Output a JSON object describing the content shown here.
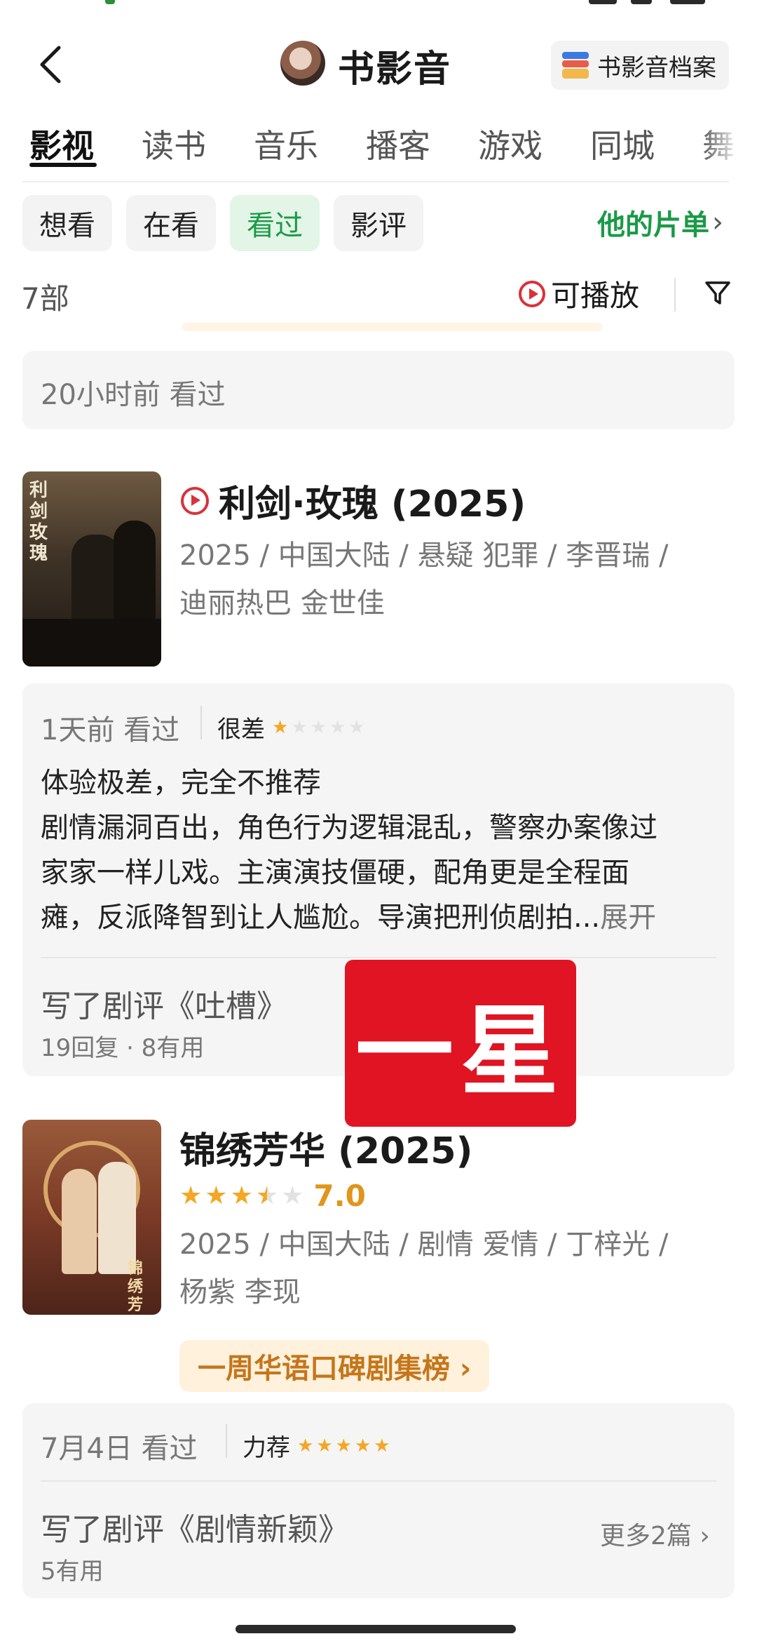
{
  "header": {
    "title": "书影音",
    "archive_label": "书影音档案"
  },
  "tabs": [
    "影视",
    "读书",
    "音乐",
    "播客",
    "游戏",
    "同城",
    "舞"
  ],
  "filters": [
    "想看",
    "在看",
    "看过",
    "影评"
  ],
  "active_filter": "看过",
  "his_list_label": "他的片单",
  "count_label": "7部",
  "playable_label": "可播放",
  "icons": [
    "back-icon",
    "avatar",
    "archive-icon",
    "play-circle-icon",
    "filter-icon",
    "chevron-right-icon",
    "star-icon"
  ],
  "colors": {
    "accent_green": "#1a9a47",
    "play_red": "#d8323a",
    "star_orange": "#f5a623",
    "stamp_red": "#e01422",
    "rank_text": "#c5761a"
  },
  "top_card": {
    "watched": "20小时前 看过"
  },
  "movies": [
    {
      "title": "利剑·玫瑰 (2025)",
      "playable": true,
      "meta_line1": "2025 / 中国大陆 / 悬疑 犯罪 / 李晋瑞 /",
      "meta_line2": "迪丽热巴 金世佳",
      "poster_text": "利剑玫瑰",
      "watched": "1天前 看过",
      "rating_label": "很差",
      "user_stars": 1,
      "review_lines": [
        "体验极差，完全不推荐",
        "剧情漏洞百出，角色行为逻辑混乱，警察办案像过",
        "家家一样儿戏。主演演技僵硬，配角更是全程面",
        "瘫，反派降智到让人尴尬。导演把刑侦剧拍..."
      ],
      "expand_label": "展开",
      "review_link": "写了剧评《吐槽》",
      "review_stats": "19回复 · 8有用"
    },
    {
      "title": "锦绣芳华 (2025)",
      "playable": false,
      "score": "7.0",
      "score_stars": 3.5,
      "meta_line1": "2025 / 中国大陆 / 剧情 爱情 / 丁梓光 /",
      "meta_line2": "杨紫 李现",
      "poster_text": "锦绣芳华",
      "rank_badge": "一周华语口碑剧集榜 ›",
      "watched": "7月4日 看过",
      "rating_label": "力荐",
      "user_stars": 5,
      "review_link": "写了剧评《剧情新颖》",
      "review_stats": "5有用",
      "more_label": "更多2篇 ›"
    }
  ],
  "stamp_text": "一星"
}
